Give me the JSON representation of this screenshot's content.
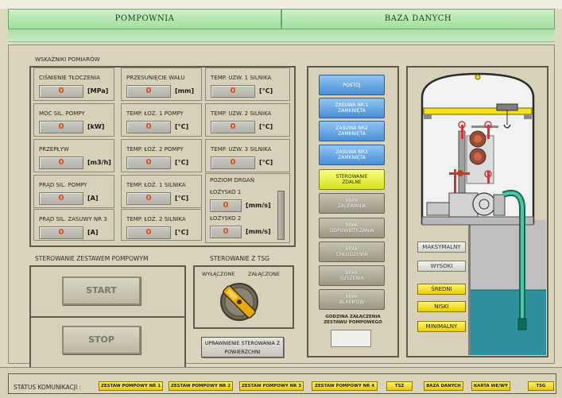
{
  "tabs": {
    "pompownia": "POMPOWNIA",
    "baza_danych": "BAZA DANYCH"
  },
  "measurements": {
    "title": "WSKAŹNIKI POMIARÓW",
    "cells": [
      {
        "label": "CIŚNIENIE TŁOCZENIA",
        "value": "0",
        "unit": "[MPa]"
      },
      {
        "label": "PRZESUNIĘCIE WAŁU",
        "value": "0",
        "unit": "[mm]"
      },
      {
        "label": "TEMP. UZW. 1 SILNIKA",
        "value": "0",
        "unit": "[°C]"
      },
      {
        "label": "MOC SIL. POMPY",
        "value": "0",
        "unit": "[kW]"
      },
      {
        "label": "TEMP. ŁOŻ. 1 POMPY",
        "value": "0",
        "unit": "[°C]"
      },
      {
        "label": "TEMP. UZW. 2 SILNIKA",
        "value": "0",
        "unit": "[°C]"
      },
      {
        "label": "PRZEPŁYW",
        "value": "0",
        "unit": "[m3/h]"
      },
      {
        "label": "TEMP. ŁOŻ. 2 POMPY",
        "value": "0",
        "unit": "[°C]"
      },
      {
        "label": "TEMP. UZW. 3 SILNIKA",
        "value": "0",
        "unit": "[°C]"
      },
      {
        "label": "PRĄD SIL. POMPY",
        "value": "0",
        "unit": "[A]"
      },
      {
        "label": "TEMP. ŁOŻ. 1 SILNIKA",
        "value": "0",
        "unit": "[°C]"
      },
      {
        "label": "PRĄD SIL. ZASUWY NR 3",
        "value": "0",
        "unit": "[A]"
      },
      {
        "label": "TEMP. ŁOŻ. 2 SILNIKA",
        "value": "0",
        "unit": "[°C]"
      }
    ],
    "vibration": {
      "title": "POZIOM DRGAŃ",
      "b1_label": "ŁOŻYSKO 1",
      "b1_value": "0",
      "b1_unit": "[mm/s]",
      "b2_label": "ŁOŻYSKO 2",
      "b2_value": "0",
      "b2_unit": "[mm/s]"
    }
  },
  "pump_control": {
    "title": "STEROWANIE ZESTAWEM POMPOWYM",
    "start": "START",
    "stop": "STOP"
  },
  "tsg_control": {
    "title": "STEROWANIE Z TSG",
    "off": "WYŁĄCZONE",
    "on": "ZAŁĄCZONE",
    "authorize": "UPRAWNIENIE STEROWANIA Z POWIERZCHNI"
  },
  "status_buttons": [
    {
      "line1": "POSTÓJ",
      "line2": "",
      "style": "blue"
    },
    {
      "line1": "ZASUWA NR.1",
      "line2": "ZAMKNIĘTA",
      "style": "blue"
    },
    {
      "line1": "ZASUWA NR2",
      "line2": "ZAMKNIĘTA",
      "style": "blue"
    },
    {
      "line1": "ZASUWA NR3",
      "line2": "ZAMKNIĘTA",
      "style": "blue"
    },
    {
      "line1": "STEROWANIE",
      "line2": "ZDALNE",
      "style": "yellow"
    },
    {
      "line1": "BRAK",
      "line2": "ZALEWANIA",
      "style": "gray"
    },
    {
      "line1": "BRAK",
      "line2": "ODPOWIETRZANIA",
      "style": "gray"
    },
    {
      "line1": "BRAK",
      "line2": "CHŁODZENIA",
      "style": "gray"
    },
    {
      "line1": "BRAK",
      "line2": "SUSZENIA",
      "style": "gray"
    },
    {
      "line1": "BRAK",
      "line2": "ALARMÓW",
      "style": "gray"
    }
  ],
  "switch_time": {
    "line1": "GODZINA ZAŁĄCZENIA",
    "line2": "ZESTAWU POMPOWEGO",
    "value": ""
  },
  "levels": [
    {
      "label": "MAKSYMALNY",
      "active": false
    },
    {
      "label": "WYSOKI",
      "active": false
    },
    {
      "label": "ŚREDNI",
      "active": true
    },
    {
      "label": "NISKI",
      "active": true
    },
    {
      "label": "MINIMALNY",
      "active": true
    }
  ],
  "status_bar": {
    "label": "STATUS KOMUNIKACJI :",
    "items": [
      "ZESTAW POMPOWY NR 1",
      "ZESTAW POMPOWY NR 2",
      "ZESTAW POMPOWY NR 3",
      "ZESTAW POMPOWY NR 4",
      "TSZ",
      "BAZA DANYCH",
      "KARTA WE/WY",
      "TSG"
    ]
  },
  "colors": {
    "tab_green": "#a4dda0",
    "status_blue": "#4b8fd6",
    "status_yellow": "#d5e316",
    "water": "#2f8f9c",
    "crane_yellow": "#f2e21a",
    "bar_yellow": "#e9c804"
  }
}
